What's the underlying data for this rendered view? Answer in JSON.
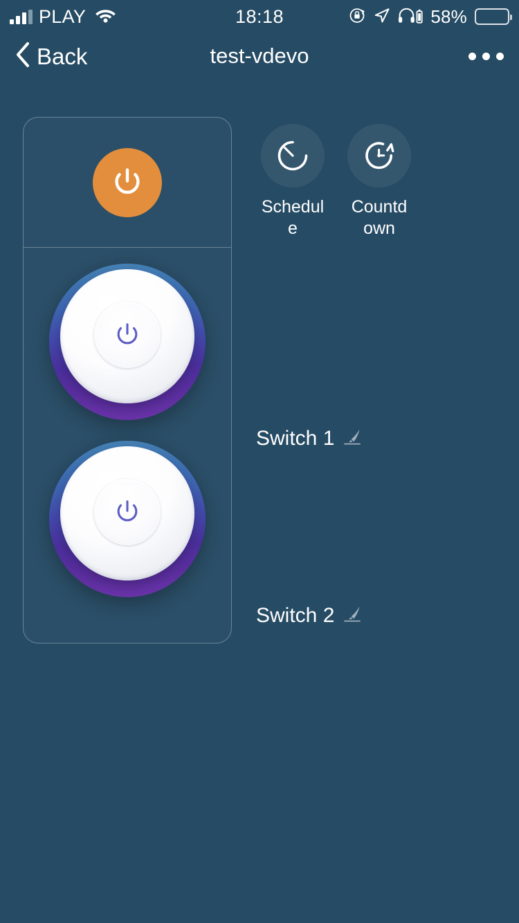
{
  "status_bar": {
    "carrier": "PLAY",
    "signal_icon": "signal-bars-icon",
    "wifi_icon": "wifi-icon",
    "time": "18:18",
    "rotation_lock_icon": "rotation-lock-icon",
    "location_icon": "location-arrow-icon",
    "headphones_icon": "headphones-icon",
    "battery_percent": "58%",
    "battery_level": 58,
    "battery_icon": "battery-icon"
  },
  "nav_bar": {
    "back_label": "Back",
    "back_icon": "chevron-left-icon",
    "title": "test-vdevo",
    "more_icon": "more-options-icon"
  },
  "device_card": {
    "master_power": {
      "icon": "power-icon",
      "state": "on",
      "color": "#E38E3C"
    },
    "switches": [
      {
        "icon": "power-icon",
        "state": "off"
      },
      {
        "icon": "power-icon",
        "state": "off"
      }
    ]
  },
  "quick_actions": [
    {
      "label": "Schedule",
      "icon": "schedule-timer-icon"
    },
    {
      "label": "Countdown",
      "icon": "countdown-timer-icon"
    }
  ],
  "switch_labels": [
    {
      "name": "Switch 1",
      "edit_icon": "edit-pencil-icon"
    },
    {
      "name": "Switch 2",
      "edit_icon": "edit-pencil-icon"
    }
  ],
  "theme": {
    "background": "#264B64",
    "card_border": "rgba(255,255,255,0.30)",
    "accent_orange": "#E38E3C",
    "knob_gradient_top": "#4682B4",
    "knob_gradient_bottom": "#5B2E9E",
    "power_icon_purple": "#5B5BC4",
    "text_primary": "#FFFFFF"
  }
}
